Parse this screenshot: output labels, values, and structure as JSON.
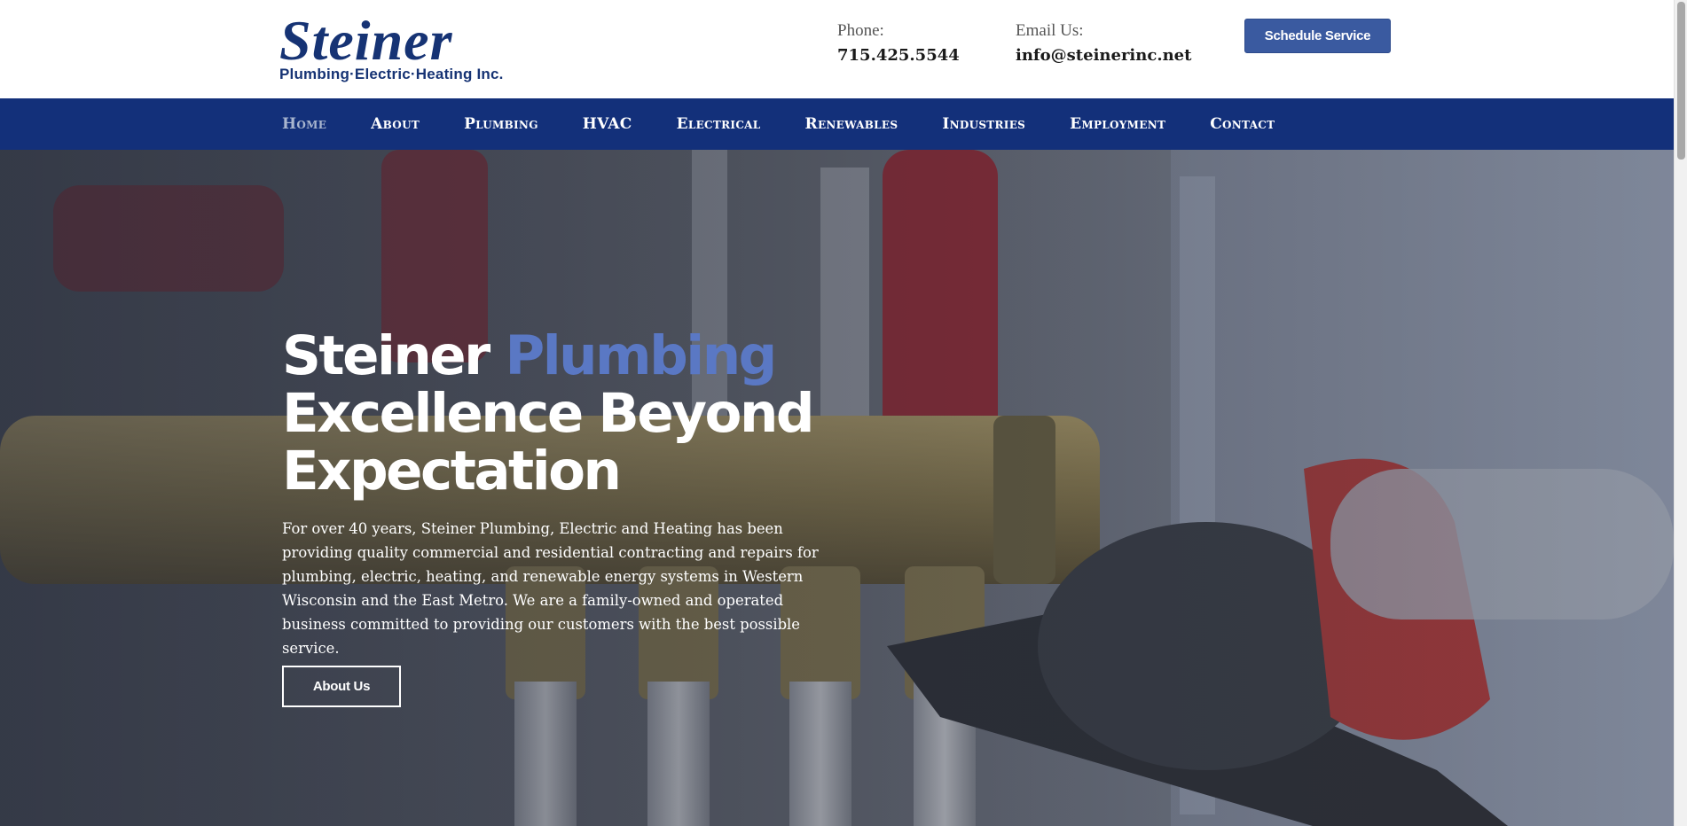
{
  "brand": {
    "logo_main": "Steiner",
    "logo_sub": "Plumbing·Electric·Heating Inc."
  },
  "header": {
    "phone_label": "Phone:",
    "phone_value": "715.425.5544",
    "email_label": "Email Us:",
    "email_value": "info@steinerinc.net",
    "schedule_label": "Schedule Service"
  },
  "nav": {
    "items": [
      {
        "label": "Home",
        "active": true
      },
      {
        "label": "About"
      },
      {
        "label": "Plumbing"
      },
      {
        "label": "HVAC"
      },
      {
        "label": "Electrical"
      },
      {
        "label": "Renewables"
      },
      {
        "label": "Industries"
      },
      {
        "label": "Employment"
      },
      {
        "label": "Contact"
      }
    ]
  },
  "hero": {
    "title_word1": "Steiner",
    "title_accent": "Plumbing",
    "title_line2": "Excellence Beyond",
    "title_line3": "Expectation",
    "description": "For over 40 years, Steiner Plumbing, Electric and Heating has been providing quality commercial and residential contracting and repairs for plumbing, electric, heating, and renewable energy systems in Western Wisconsin and the East Metro. We are a family-owned and operated business committed to providing our customers with the best possible service.",
    "button_label": "About Us"
  },
  "colors": {
    "brand_navy": "#163374",
    "nav_bg": "#13307a",
    "accent_blue": "#5a78c4",
    "button_blue": "#3a5aa0"
  }
}
